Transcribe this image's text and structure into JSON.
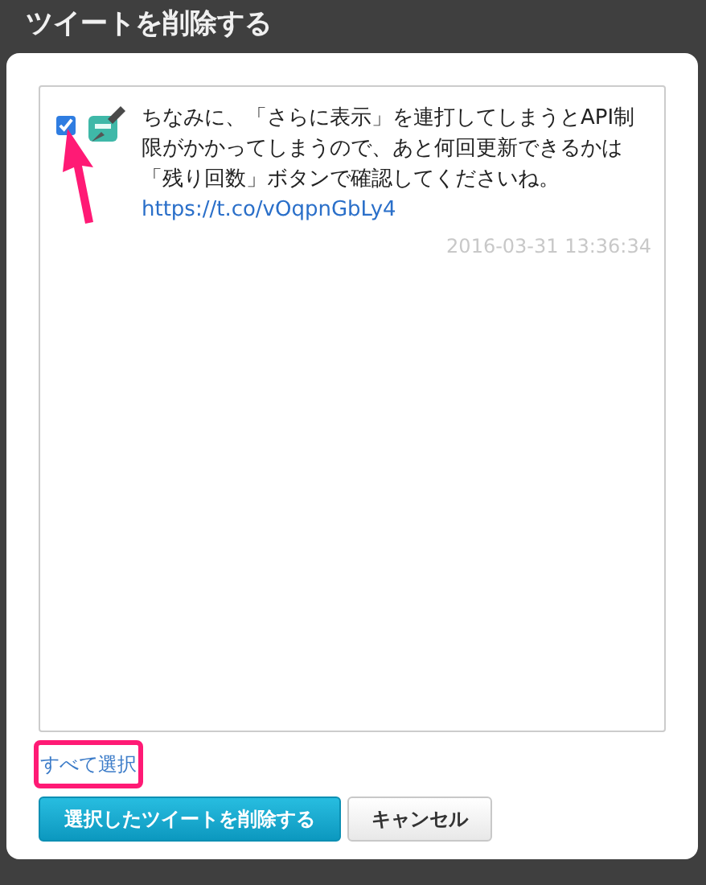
{
  "dialog_title": "ツイートを削除する",
  "tweets": [
    {
      "selected": true,
      "text": "ちなみに、「さらに表示」を連打してしまうとAPI制限がかかってしまうので、あと何回更新できるかは「残り回数」ボタンで確認してくださいね。",
      "link": "https://t.co/vOqpnGbLy4",
      "timestamp": "2016-03-31 13:36:34"
    }
  ],
  "select_all_link": "すべて選択",
  "buttons": [
    {
      "label": "選択したツイートを削除する",
      "kind": "primary"
    },
    {
      "label": "キャンセル",
      "kind": "default"
    }
  ]
}
